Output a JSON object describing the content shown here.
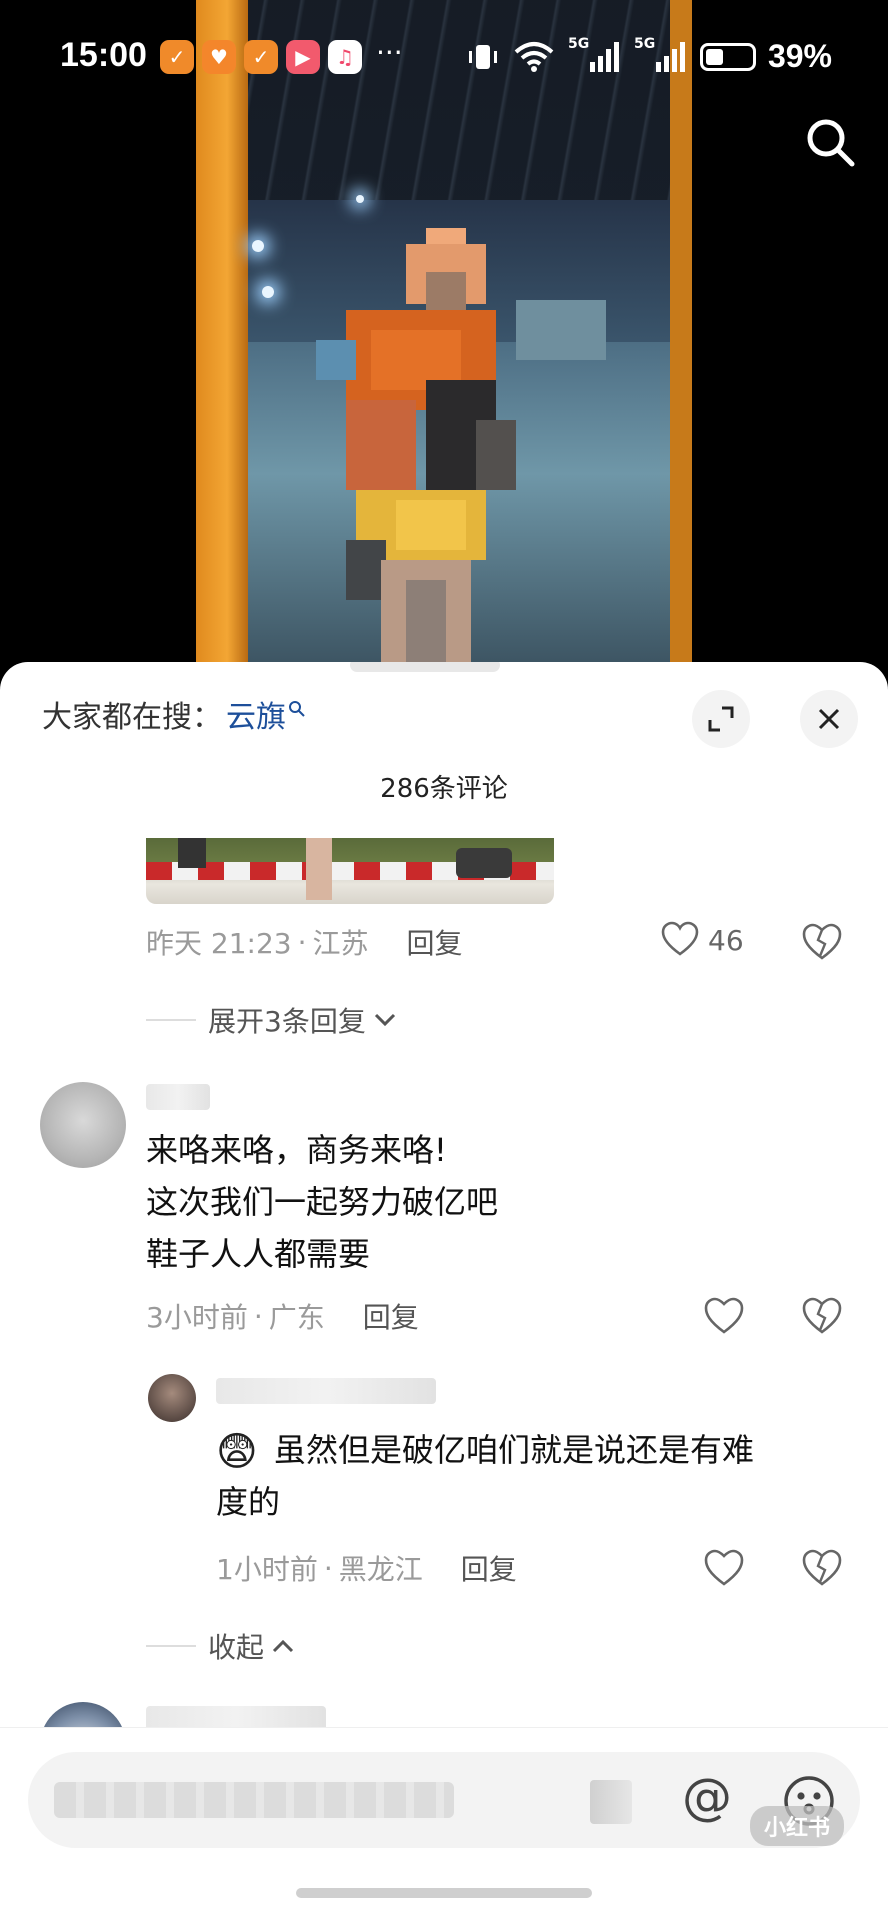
{
  "status_bar": {
    "time": "15:00",
    "battery": "39%",
    "battery_level": 0.39,
    "network_1": "5G",
    "network_2": "5G",
    "icons": [
      "app-icon-orange-1",
      "app-icon-heart",
      "app-icon-orange-2",
      "app-icon-play",
      "app-icon-music"
    ],
    "more": "···"
  },
  "search_hint": {
    "prefix": "大家都在搜：",
    "keyword": "云旗",
    "color": "#1d4f9a"
  },
  "comments_header": {
    "count_text": "286条评论"
  },
  "comment1": {
    "time": "昨天 21:23",
    "location": "江苏",
    "reply": "回复",
    "likes": "46",
    "expand": "展开3条回复"
  },
  "comment2": {
    "text": "来咯来咯，商务来咯!\n这次我们一起努力破亿吧\n鞋子人人都需要",
    "time": "3小时前",
    "location": "广东",
    "reply": "回复",
    "reply_item": {
      "emoji": "😨",
      "text": "虽然但是破亿咱们就是说还是有难\n度的",
      "time": "1小时前",
      "location": "黑龙江",
      "reply": "回复"
    },
    "collapse": "收起"
  },
  "bottom_bar": {
    "at": "@",
    "watermark": "小红书"
  }
}
